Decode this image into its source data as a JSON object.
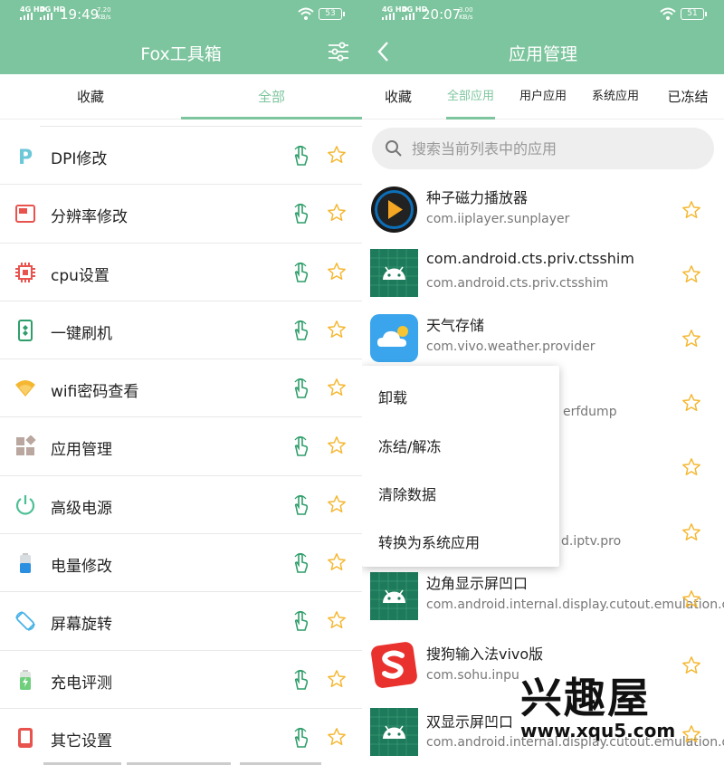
{
  "left": {
    "status": {
      "net1": "4G HD",
      "net2": "4G HD",
      "time": "19:49",
      "speed_value": "7.20",
      "speed_unit": "KB/s",
      "battery": "53"
    },
    "appbar": {
      "title": "Fox工具箱"
    },
    "tabs": [
      {
        "label": "收藏",
        "active": false
      },
      {
        "label": "全部",
        "active": true
      }
    ],
    "tools": [
      {
        "label": "DPI修改",
        "icon": "dpi-p-icon"
      },
      {
        "label": "分辨率修改",
        "icon": "resolution-icon"
      },
      {
        "label": "cpu设置",
        "icon": "cpu-chip-icon"
      },
      {
        "label": "一键刷机",
        "icon": "phone-flash-icon"
      },
      {
        "label": "wifi密码查看",
        "icon": "wifi-icon"
      },
      {
        "label": "应用管理",
        "icon": "apps-grid-icon"
      },
      {
        "label": "高级电源",
        "icon": "power-icon"
      },
      {
        "label": "电量修改",
        "icon": "battery-icon"
      },
      {
        "label": "屏幕旋转",
        "icon": "rotate-screen-icon"
      },
      {
        "label": "充电评测",
        "icon": "charging-icon"
      },
      {
        "label": "其它设置",
        "icon": "other-settings-icon"
      }
    ]
  },
  "right": {
    "status": {
      "net1": "4G HD",
      "net2": "4G HD",
      "time": "20:07",
      "speed_value": "3.00",
      "speed_unit": "KB/s",
      "battery": "51"
    },
    "appbar": {
      "title": "应用管理"
    },
    "tabs": [
      {
        "label": "收藏",
        "active": false
      },
      {
        "label": "全部应用",
        "active": true
      },
      {
        "label": "用户应用",
        "active": false
      },
      {
        "label": "系统应用",
        "active": false
      },
      {
        "label": "已冻结",
        "active": false
      }
    ],
    "search": {
      "placeholder": "搜索当前列表中的应用"
    },
    "apps": [
      {
        "name": "种子磁力播放器",
        "package": "com.iiplayer.sunplayer",
        "icon": "play-icon"
      },
      {
        "name": "com.android.cts.priv.ctsshim",
        "package": "com.android.cts.priv.ctsshim",
        "icon": "android-icon"
      },
      {
        "name": "天气存储",
        "package": "com.vivo.weather.provider",
        "icon": "weather-cloud-icon"
      },
      {
        "name": "",
        "package": "erfdump",
        "icon": ""
      },
      {
        "name": "",
        "package": "",
        "icon": ""
      },
      {
        "name": "",
        "package": "d.iptv.pro",
        "icon": ""
      },
      {
        "name": "边角显示屏凹口",
        "package": "com.android.internal.display.cutout.emulation.corner",
        "icon": "android-icon"
      },
      {
        "name": "搜狗输入法vivo版",
        "package": "com.sohu.inpu",
        "icon": "sogou-s-icon"
      },
      {
        "name": "双显示屏凹口",
        "package": "com.android.internal.display.cutout.emulation.double",
        "icon": "android-icon"
      }
    ],
    "context_menu": [
      "卸载",
      "冻结/解冻",
      "清除数据",
      "转换为系统应用"
    ],
    "watermark": {
      "big": "兴趣屋",
      "url": "www.xqu5.com"
    }
  },
  "colors": {
    "accent": "#7dc59e",
    "star": "#f5b731"
  }
}
